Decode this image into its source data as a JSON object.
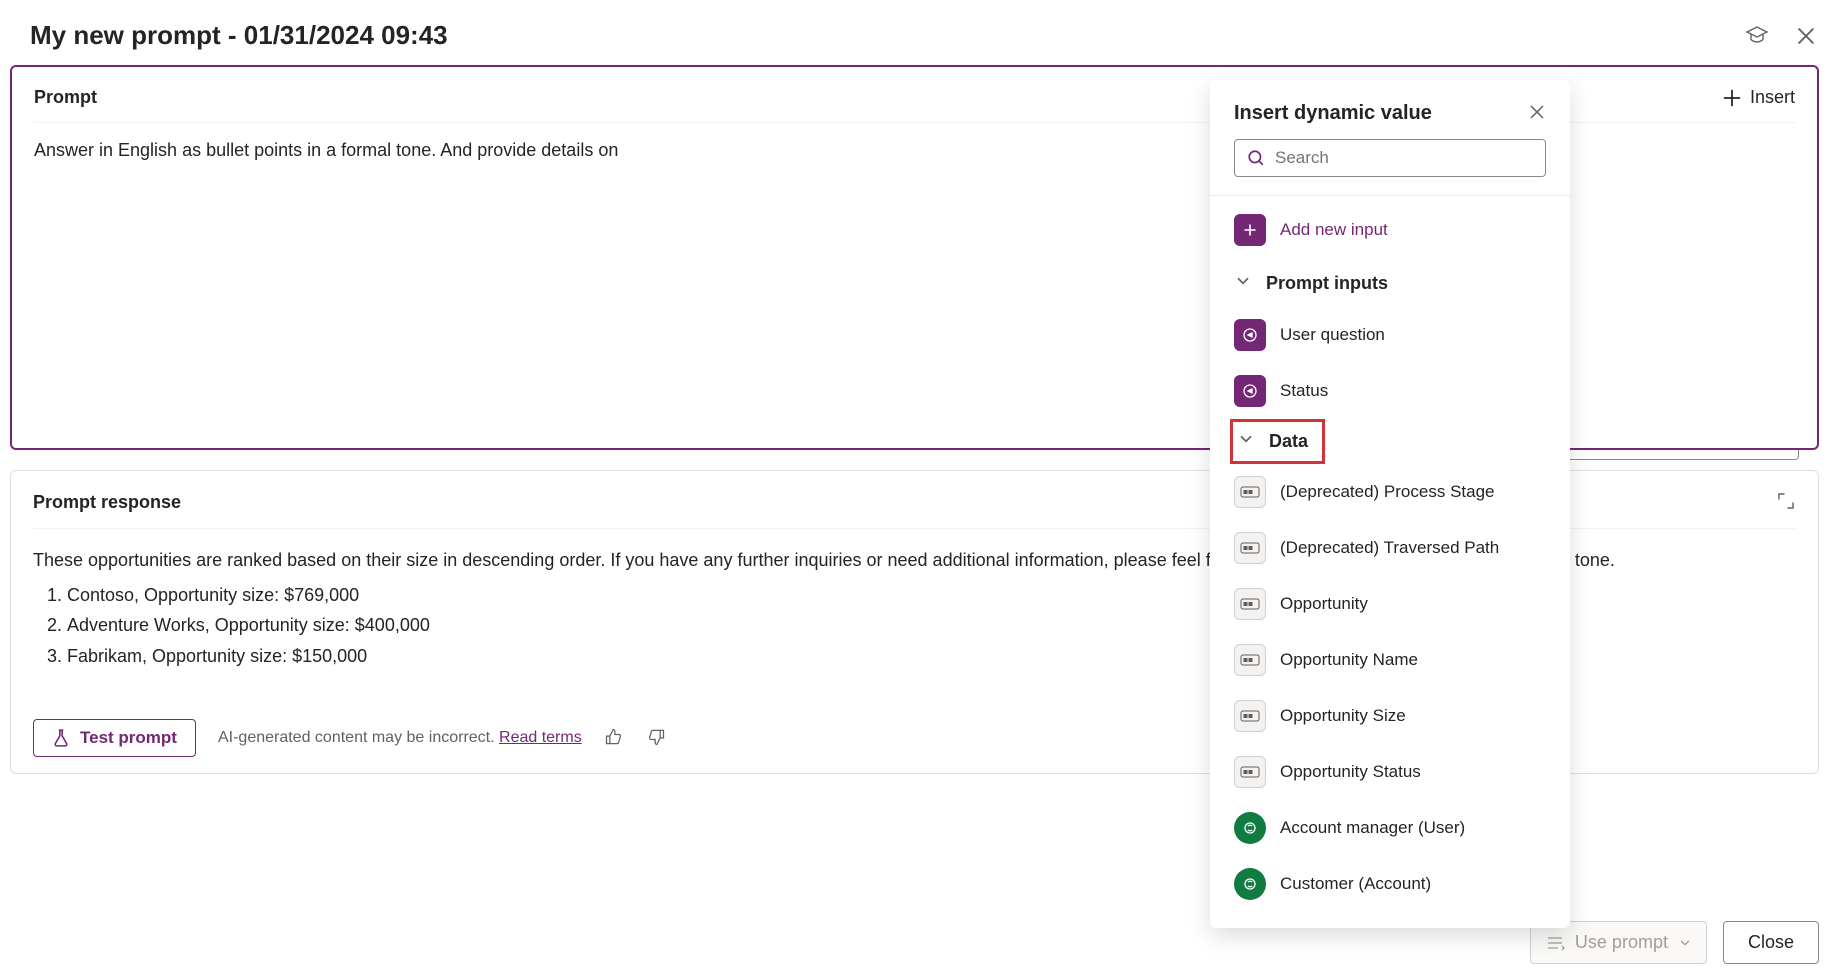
{
  "header": {
    "title": "My new prompt - 01/31/2024 09:43"
  },
  "prompt": {
    "section_label": "Prompt",
    "insert_label": "Insert",
    "text": "Answer in English as bullet points in a formal tone. And provide details on"
  },
  "response": {
    "section_label": "Prompt response",
    "intro": "These opportunities are ranked based on their size in descending order. If you have any further inquiries or need additional information, please feel free to ask. I am here to assist you in a formal tone.",
    "items": [
      "Contoso, Opportunity size: $769,000",
      "Adventure Works, Opportunity size: $400,000",
      "Fabrikam, Opportunity size: $150,000"
    ],
    "test_label": "Test prompt",
    "disclaimer": "AI-generated content may be incorrect.",
    "read_terms": "Read terms"
  },
  "dynamic_panel": {
    "title": "Insert dynamic value",
    "search_placeholder": "Search",
    "add_new_label": "Add new input",
    "sections": {
      "prompt_inputs": {
        "label": "Prompt inputs",
        "items": [
          "User question",
          "Status"
        ]
      },
      "data": {
        "label": "Data",
        "items": [
          {
            "label": "(Deprecated) Process Stage",
            "type": "text"
          },
          {
            "label": "(Deprecated) Traversed Path",
            "type": "text"
          },
          {
            "label": "Opportunity",
            "type": "text"
          },
          {
            "label": "Opportunity Name",
            "type": "text"
          },
          {
            "label": "Opportunity Size",
            "type": "text"
          },
          {
            "label": "Opportunity Status",
            "type": "text"
          },
          {
            "label": "Account manager (User)",
            "type": "lookup"
          },
          {
            "label": "Customer (Account)",
            "type": "lookup"
          }
        ]
      }
    }
  },
  "bottom": {
    "use_prompt": "Use prompt",
    "close": "Close"
  }
}
